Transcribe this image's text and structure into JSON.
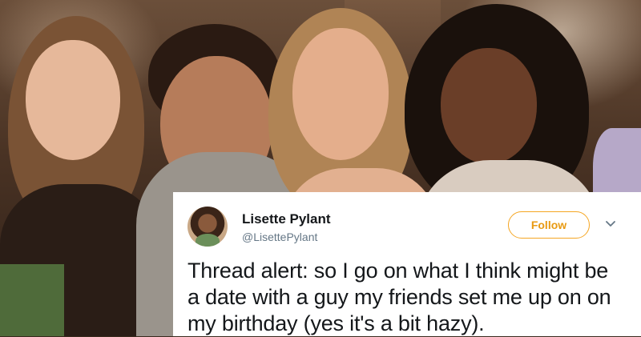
{
  "tweet": {
    "author_name": "Lisette Pylant",
    "author_handle": "@LisettePylant",
    "follow_label": "Follow",
    "text": "Thread alert: so I go on what I think might be a date with a guy my friends set me up on on my birthday (yes it's a bit hazy)."
  },
  "colors": {
    "follow_accent": "#f5a623",
    "handle_gray": "#657786",
    "text_dark": "#14171a"
  },
  "icons": {
    "more_options": "chevron-down-icon"
  }
}
